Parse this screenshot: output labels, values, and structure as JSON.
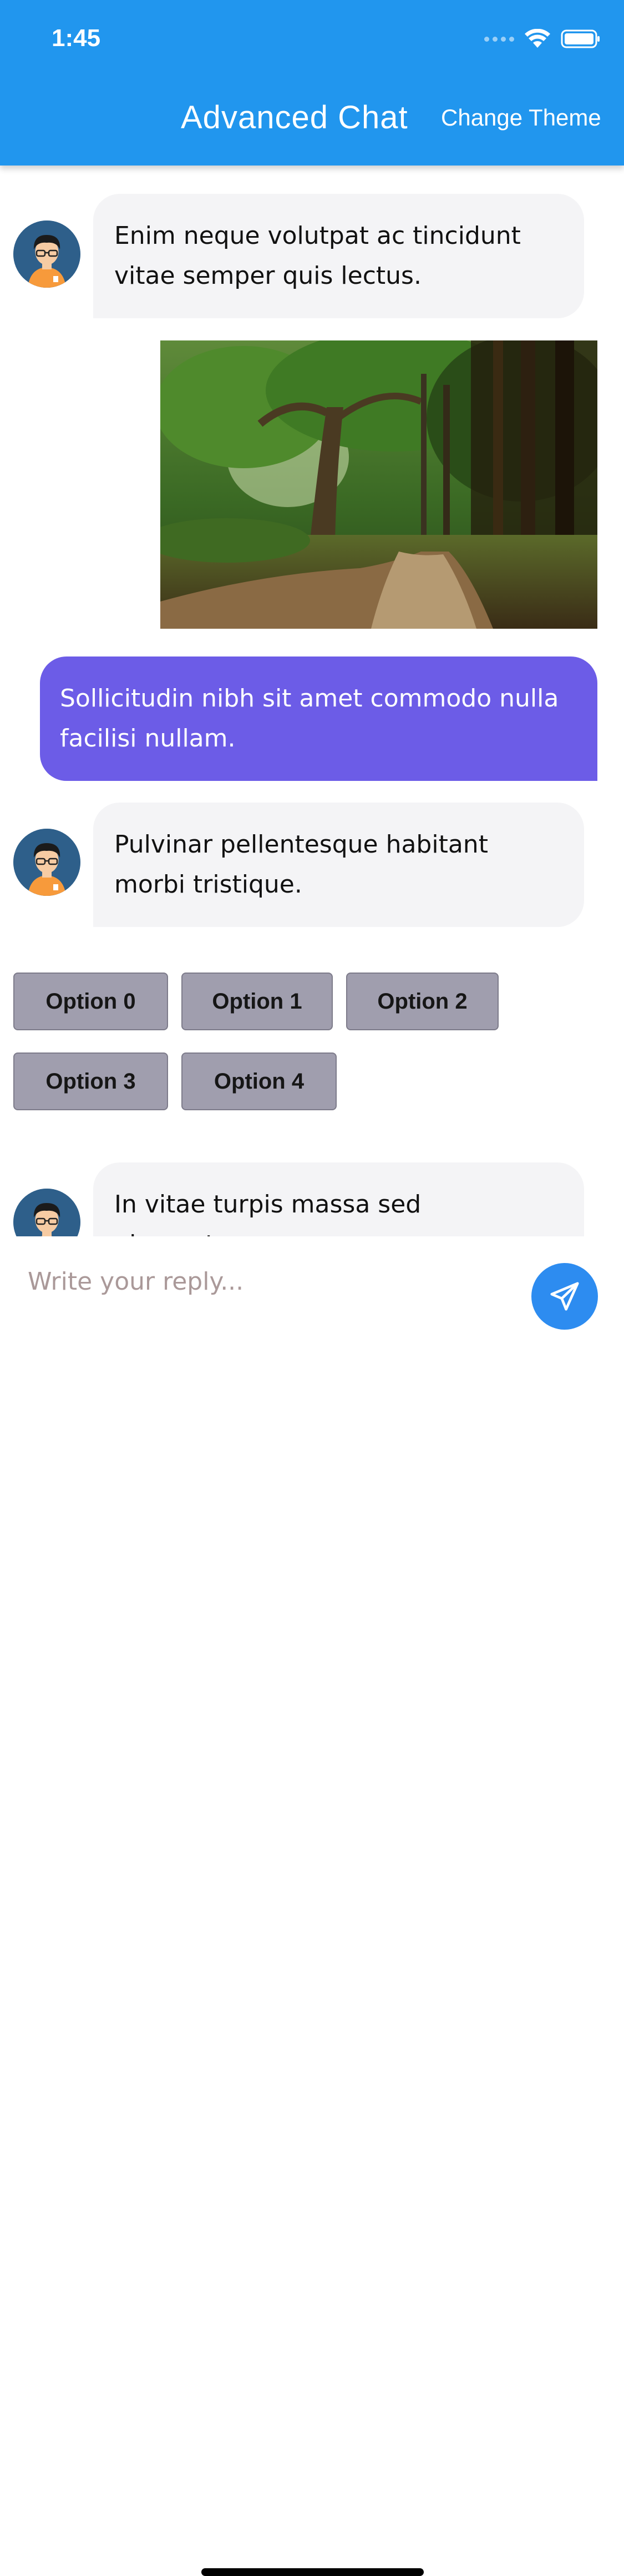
{
  "status_bar": {
    "time": "1:45"
  },
  "header": {
    "title": "Advanced Chat",
    "theme_button": "Change Theme"
  },
  "messages": [
    {
      "from": "bot",
      "text": "Enim neque volutpat ac tincidunt vitae semper quis lectus."
    },
    {
      "from": "user",
      "type": "image"
    },
    {
      "from": "user",
      "text": "Sollicitudin nibh sit amet commodo nulla facilisi nullam."
    },
    {
      "from": "bot",
      "text": "Pulvinar pellentesque habitant morbi tristique."
    },
    {
      "from": "bot",
      "text": "In vitae turpis massa sed elementum"
    }
  ],
  "options": [
    "Option 0",
    "Option 1",
    "Option 2",
    "Option 3",
    "Option 4"
  ],
  "composer": {
    "placeholder": "Write your reply..."
  },
  "colors": {
    "header": "#2196ee",
    "user_bubble": "#6c5ce7",
    "bot_bubble": "#f4f4f6",
    "option_button": "#a09eae",
    "send_button": "#2d8cf0"
  },
  "icons": {
    "status": [
      "cellular-signal-icon",
      "wifi-icon",
      "battery-icon"
    ],
    "send": "send-icon",
    "avatar": "user-avatar-icon"
  }
}
